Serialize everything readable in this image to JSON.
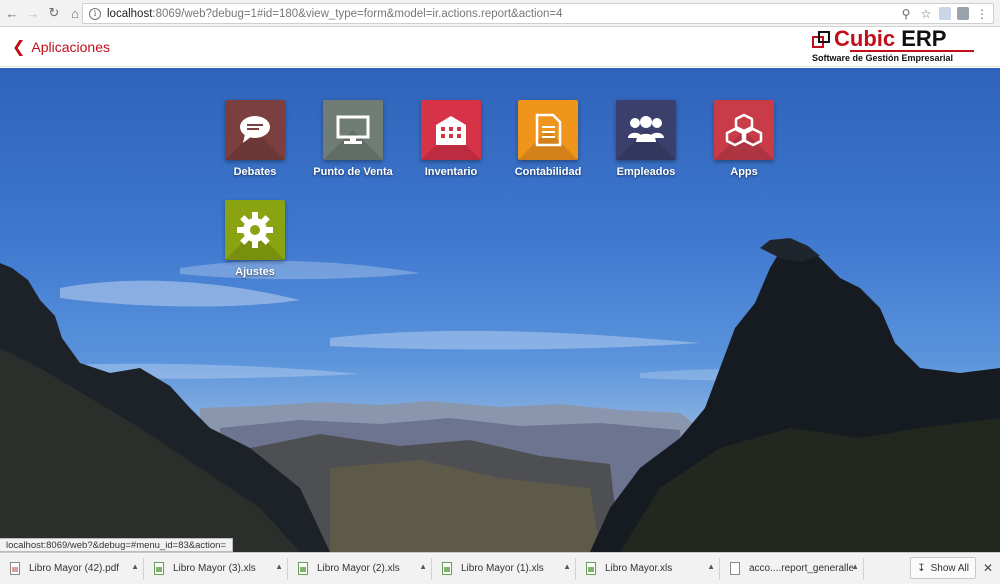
{
  "browser": {
    "url_host": "localhost",
    "url_path": ":8069/web?debug=1#id=180&view_type=form&model=ir.actions.report&action=4"
  },
  "header": {
    "back_label": "Aplicaciones",
    "brand_name": "Cubic",
    "brand_suffix": "ERP",
    "brand_tagline": "Software de Gestión Empresarial",
    "accent_color": "#c20e1a"
  },
  "apps": [
    {
      "label": "Debates",
      "icon": "chat-bubble-icon",
      "color": "#7c3f3f"
    },
    {
      "label": "Punto de Venta",
      "icon": "monitor-icon",
      "color": "#6f7d74"
    },
    {
      "label": "Inventario",
      "icon": "building-icon",
      "color": "#d63248"
    },
    {
      "label": "Contabilidad",
      "icon": "document-icon",
      "color": "#f0951c"
    },
    {
      "label": "Empleados",
      "icon": "people-icon",
      "color": "#3b3f6b"
    },
    {
      "label": "Apps",
      "icon": "cubes-icon",
      "color": "#c83c4a"
    },
    {
      "label": "Ajustes",
      "icon": "gear-icon",
      "color": "#8aa310"
    }
  ],
  "status_url": "localhost:8069/web?&debug=#menu_id=83&action=",
  "downloads": [
    {
      "name": "Libro Mayor (42).pdf",
      "type": "pdf"
    },
    {
      "name": "Libro Mayor (3).xls",
      "type": "xls"
    },
    {
      "name": "Libro Mayor (2).xls",
      "type": "xls"
    },
    {
      "name": "Libro Mayor (1).xls",
      "type": "xls"
    },
    {
      "name": "Libro Mayor.xls",
      "type": "xls"
    },
    {
      "name": "acco....report_generalledger",
      "type": "file"
    }
  ],
  "shelf": {
    "show_all_label": "Show All"
  }
}
